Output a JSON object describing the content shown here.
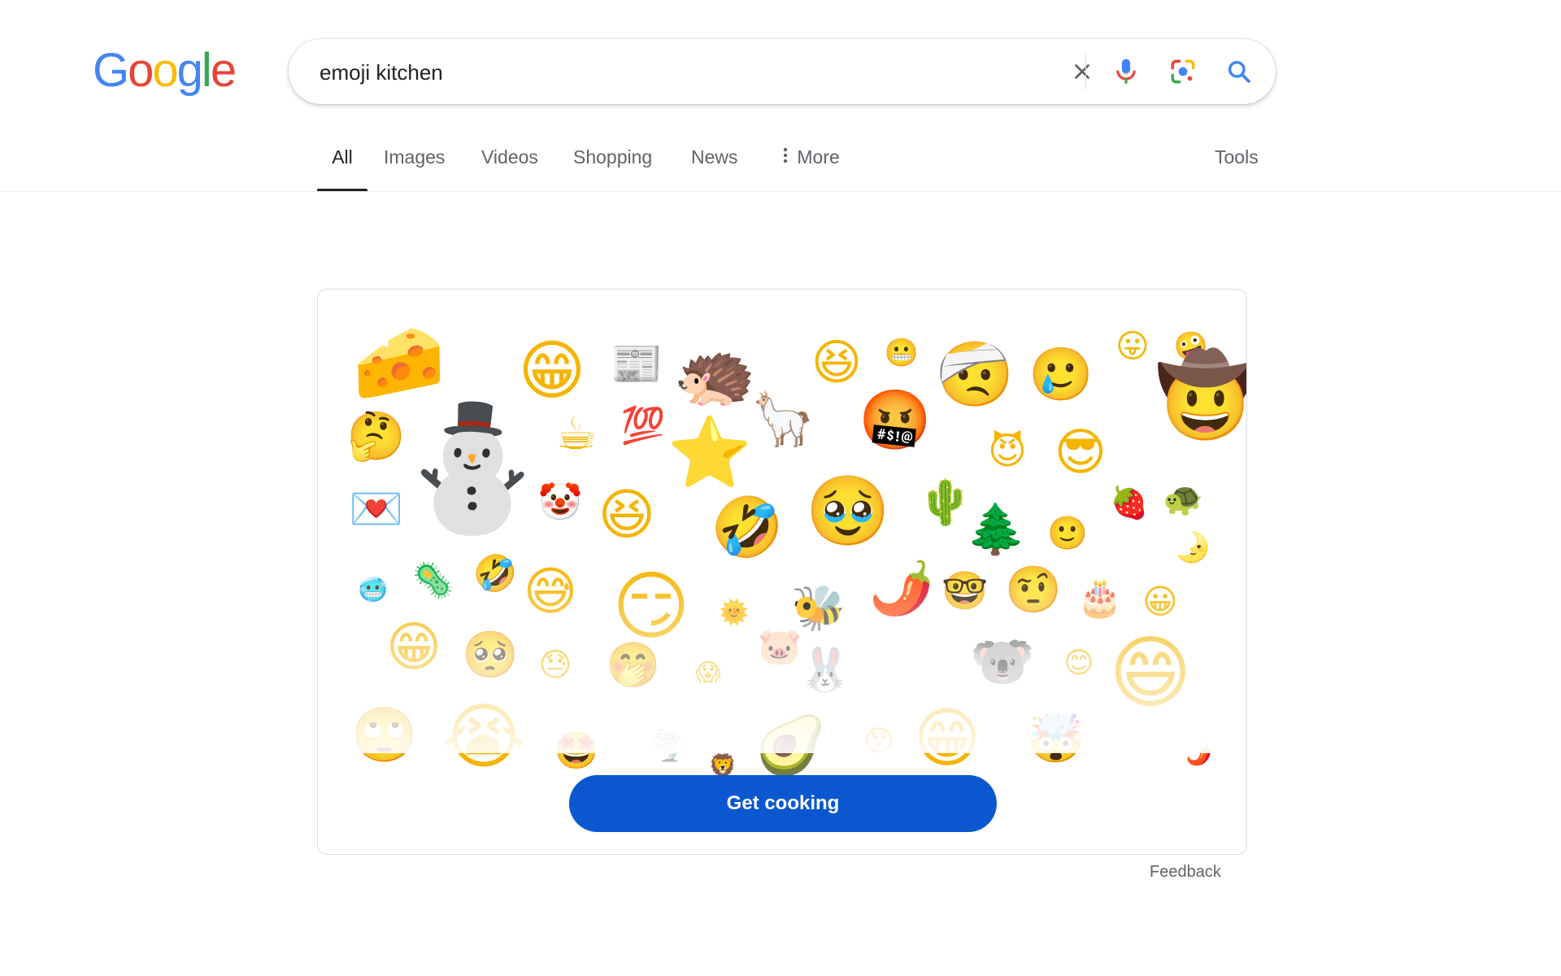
{
  "logo": {
    "letters": [
      {
        "char": "G",
        "color": "#4285F4"
      },
      {
        "char": "o",
        "color": "#EA4335"
      },
      {
        "char": "o",
        "color": "#FBBC05"
      },
      {
        "char": "g",
        "color": "#4285F4"
      },
      {
        "char": "l",
        "color": "#34A853"
      },
      {
        "char": "e",
        "color": "#EA4335"
      }
    ]
  },
  "search": {
    "query": "emoji kitchen",
    "icons": [
      "clear-icon",
      "microphone-icon",
      "google-lens-icon",
      "search-icon"
    ]
  },
  "tabs": [
    {
      "label": "All",
      "active": true
    },
    {
      "label": "Images",
      "active": false
    },
    {
      "label": "Videos",
      "active": false
    },
    {
      "label": "Shopping",
      "active": false
    },
    {
      "label": "News",
      "active": false
    },
    {
      "label": "More",
      "active": false,
      "icon": "more-vert-icon"
    }
  ],
  "tools_label": "Tools",
  "card": {
    "button_label": "Get cooking",
    "emojis": [
      "🧀",
      "😁",
      "📰",
      "🦔",
      "😆",
      "😬",
      "🤕",
      "🥲",
      "😛",
      "🤪",
      "🤠",
      "🤔",
      "⛄",
      "☕",
      "💯",
      "⭐",
      "🦙",
      "🤬",
      "😈",
      "😎",
      "💌",
      "🤡",
      "😆",
      "🤣",
      "🥹",
      "🌵",
      "🌲",
      "🙂",
      "🍓",
      "🐢",
      "🌛",
      "🥶",
      "🦠",
      "🤣",
      "😅",
      "😏",
      "🌞",
      "🐝",
      "🌶️",
      "🤓",
      "🤨",
      "🎂",
      "😀",
      "😁",
      "🥺",
      "😓",
      "🤭",
      "😱",
      "🐷",
      "🐰",
      "🐨",
      "😊",
      "😄",
      "🙄",
      "😭",
      "🤩",
      "🌪️",
      "🦁",
      "🥑",
      "😯",
      "😁",
      "🤯",
      "🌶️"
    ]
  },
  "feedback_label": "Feedback",
  "colors": {
    "accent_button": "#0b57d0",
    "active_tab_underline": "#202124"
  }
}
